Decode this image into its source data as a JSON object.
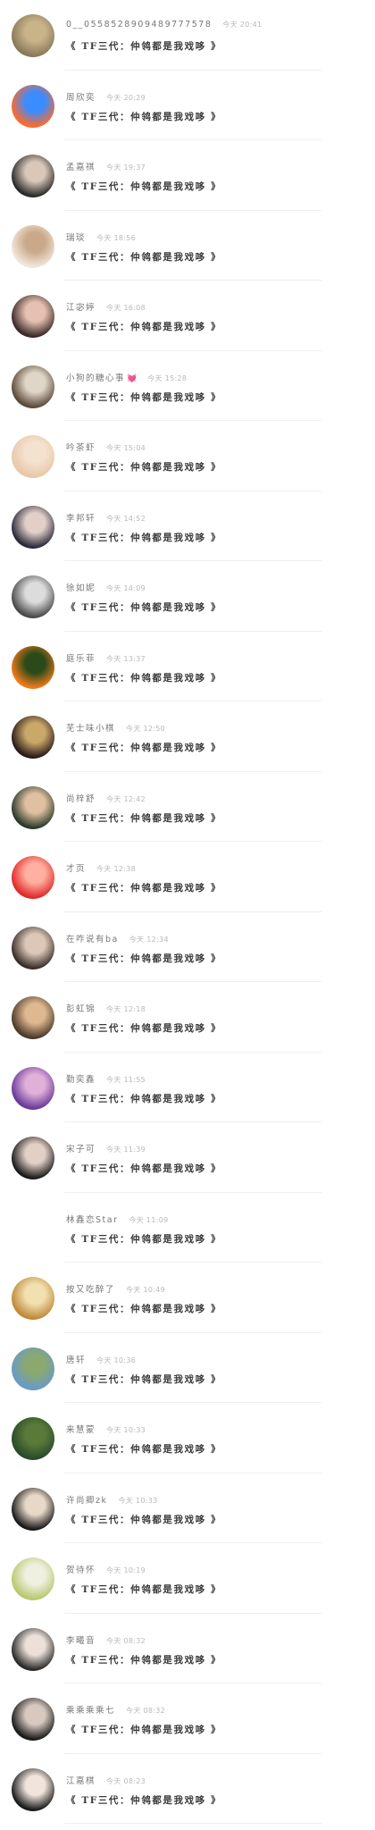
{
  "comment_preview": "《 TF三代：仲鸰都是我戏哆 》",
  "rows": [
    {
      "name": "0__0558528909489777578",
      "time": "今天 20:41",
      "avatar_colors": [
        "#8a7a5a",
        "#c9b48a"
      ]
    },
    {
      "name": "周欣奕",
      "time": "今天 20:29",
      "avatar_colors": [
        "#ff6a2a",
        "#3a8cff"
      ]
    },
    {
      "name": "孟嘉祺",
      "time": "今天 19:37",
      "avatar_colors": [
        "#2a2a2a",
        "#d9c8b8"
      ]
    },
    {
      "name": "瑞琰",
      "time": "今天 18:56",
      "avatar_colors": [
        "#f2e6da",
        "#c9a98a"
      ]
    },
    {
      "name": "江宓婷",
      "time": "今天 16:08",
      "avatar_colors": [
        "#3a2a2a",
        "#e6c0b0"
      ]
    },
    {
      "name": "小狗的糖心事",
      "time": "今天 15:28",
      "avatar_colors": [
        "#5a4a3a",
        "#e0d6c8"
      ],
      "heart": "💓"
    },
    {
      "name": "吟茶虾",
      "time": "今天 15:04",
      "avatar_colors": [
        "#e8c8a8",
        "#f4e2d0"
      ]
    },
    {
      "name": "李邦轩",
      "time": "今天 14:52",
      "avatar_colors": [
        "#2a2a3a",
        "#e2d0c8"
      ]
    },
    {
      "name": "徐如妮",
      "time": "今天 14:09",
      "avatar_colors": [
        "#4a4a4a",
        "#dcdcdc"
      ]
    },
    {
      "name": "庭乐菲",
      "time": "今天 13:37",
      "avatar_colors": [
        "#f07a1a",
        "#2a4a1a"
      ]
    },
    {
      "name": "芜士味小棋",
      "time": "今天 12:50",
      "avatar_colors": [
        "#2a1a1a",
        "#caa86a"
      ]
    },
    {
      "name": "尚梓舒",
      "time": "今天 12:42",
      "avatar_colors": [
        "#2a3a2a",
        "#e0c0a0"
      ]
    },
    {
      "name": "才页",
      "time": "今天 12:38",
      "avatar_colors": [
        "#e02a2a",
        "#ffb0a0"
      ]
    },
    {
      "name": "在咋说有ba",
      "time": "今天 12:34",
      "avatar_colors": [
        "#3a2e2a",
        "#dcc8b8"
      ]
    },
    {
      "name": "彭虹锦",
      "time": "今天 12:18",
      "avatar_colors": [
        "#4a3a2a",
        "#e0b890"
      ]
    },
    {
      "name": "勤奕鑫",
      "time": "今天 11:55",
      "avatar_colors": [
        "#6a3a9a",
        "#e0b0d8"
      ]
    },
    {
      "name": "宋子可",
      "time": "今天 11:39",
      "avatar_colors": [
        "#1a1a1a",
        "#e2cfc6"
      ]
    },
    {
      "name": "林鑫恋Star",
      "time": "今天 11:09",
      "avatar_colors": null
    },
    {
      "name": "按又吃醉了",
      "time": "今天 10:49",
      "avatar_colors": [
        "#c08a3a",
        "#f2e0b0"
      ]
    },
    {
      "name": "唐轩",
      "time": "今天 10:36",
      "avatar_colors": [
        "#6a9ac8",
        "#8aa870"
      ]
    },
    {
      "name": "来慧蒙",
      "time": "今天 10:33",
      "avatar_colors": [
        "#2a4a2a",
        "#5a7a3a"
      ]
    },
    {
      "name": "许尚卿zk",
      "time": "今天 10:33",
      "avatar_colors": [
        "#1a1a1a",
        "#e8d8c8"
      ]
    },
    {
      "name": "贺待怀",
      "time": "今天 10:19",
      "avatar_colors": [
        "#b8c870",
        "#f0f0e0"
      ]
    },
    {
      "name": "李曦音",
      "time": "今天 08:32",
      "avatar_colors": [
        "#2a2a2a",
        "#ece0d8"
      ]
    },
    {
      "name": "乘乘乘乘七",
      "time": "今天 08:32",
      "avatar_colors": [
        "#1a1a1a",
        "#d8c8c0"
      ]
    },
    {
      "name": "江嘉棋",
      "time": "今天 08:23",
      "avatar_colors": [
        "#1a1a1a",
        "#f0e4dc"
      ]
    }
  ]
}
